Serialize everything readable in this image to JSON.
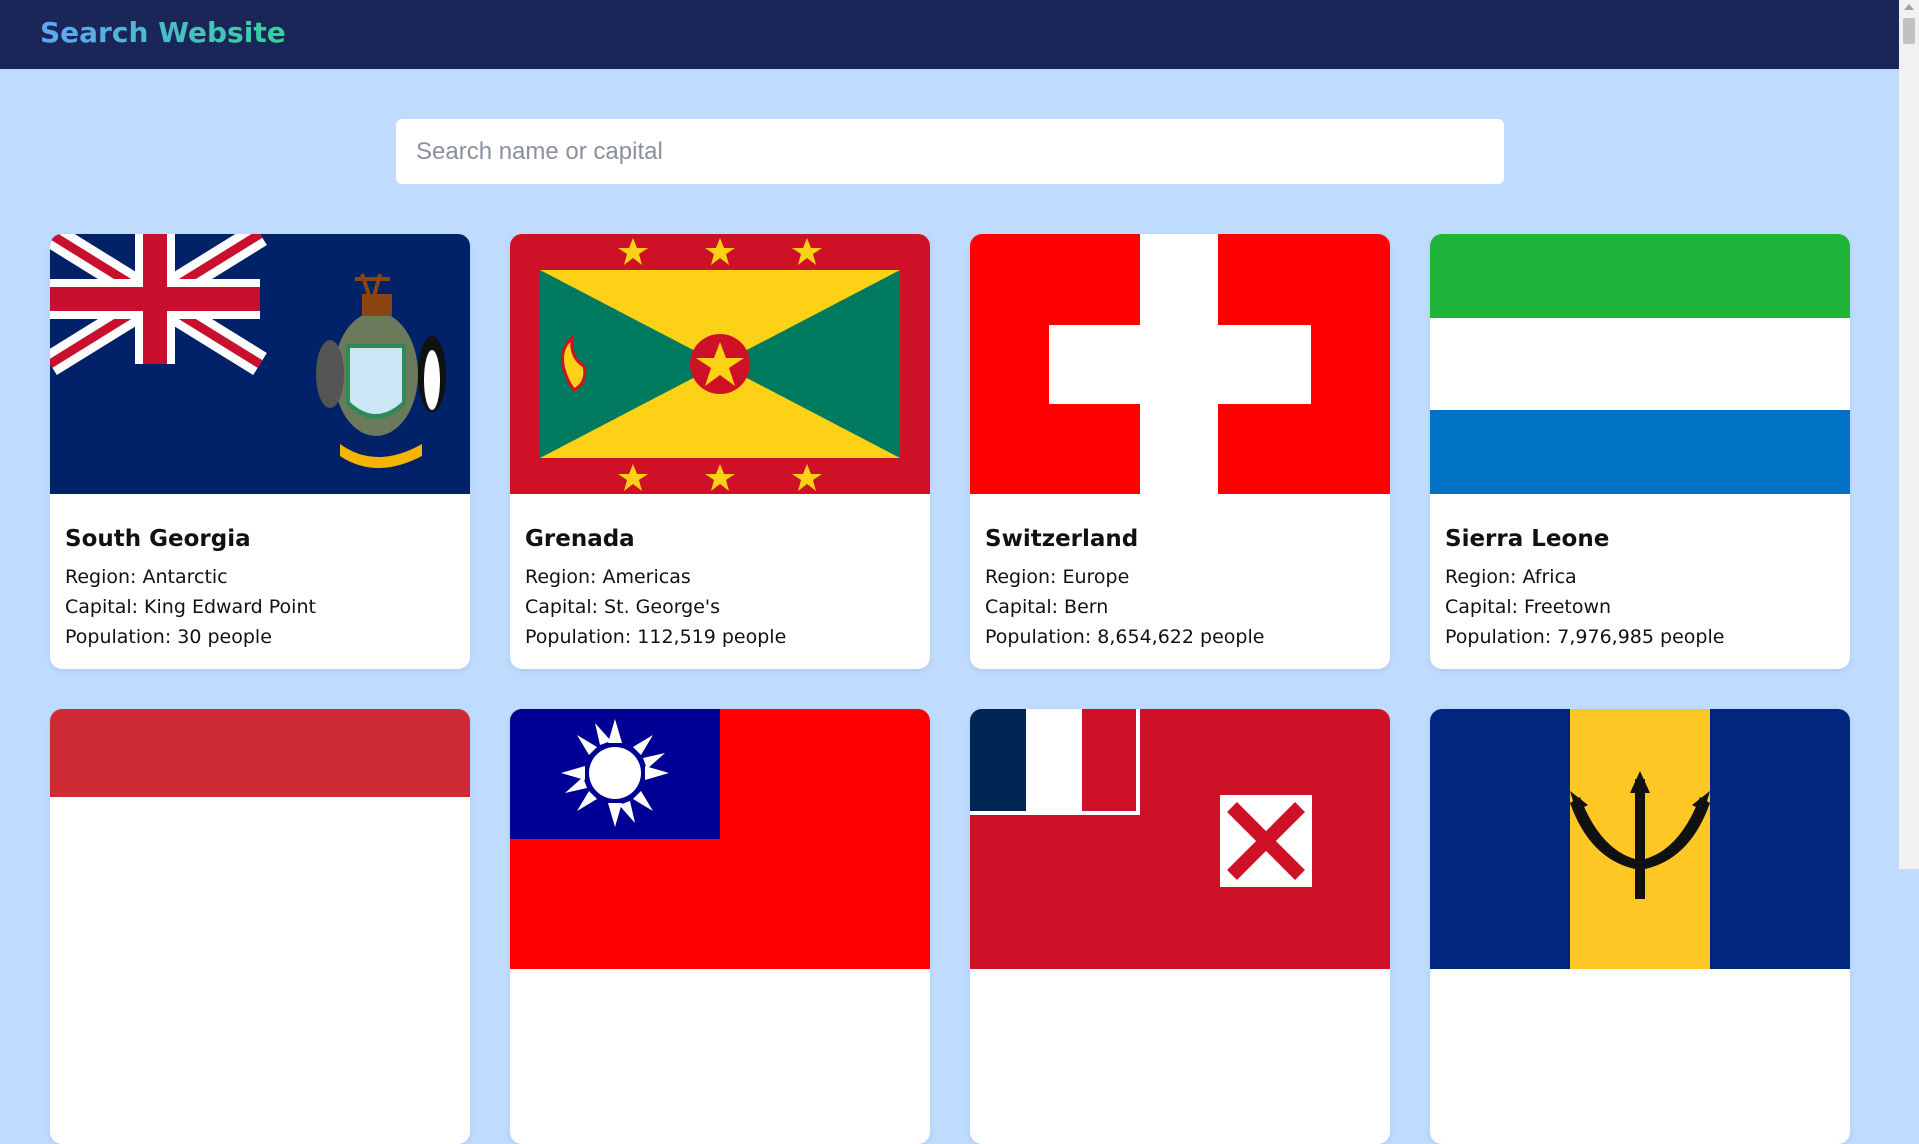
{
  "header": {
    "title": "Search Website"
  },
  "search": {
    "placeholder": "Search name or capital",
    "value": ""
  },
  "countries": [
    {
      "name": "South Georgia",
      "region": "Region: Antarctic",
      "capital": "Capital: King Edward Point",
      "population": "Population: 30 people"
    },
    {
      "name": "Grenada",
      "region": "Region: Americas",
      "capital": "Capital: St. George's",
      "population": "Population: 112,519 people"
    },
    {
      "name": "Switzerland",
      "region": "Region: Europe",
      "capital": "Capital: Bern",
      "population": "Population: 8,654,622 people"
    },
    {
      "name": "Sierra Leone",
      "region": "Region: Africa",
      "capital": "Capital: Freetown",
      "population": "Population: 7,976,985 people"
    }
  ],
  "colors": {
    "header_bg": "#1a2657",
    "page_bg": "#bfdbfe",
    "card_bg": "#ffffff"
  },
  "icons": [
    "flag-south-georgia",
    "flag-grenada",
    "flag-switzerland",
    "flag-sierra-leone",
    "flag-indonesia",
    "flag-taiwan",
    "flag-wallis-and-futuna",
    "flag-barbados"
  ]
}
